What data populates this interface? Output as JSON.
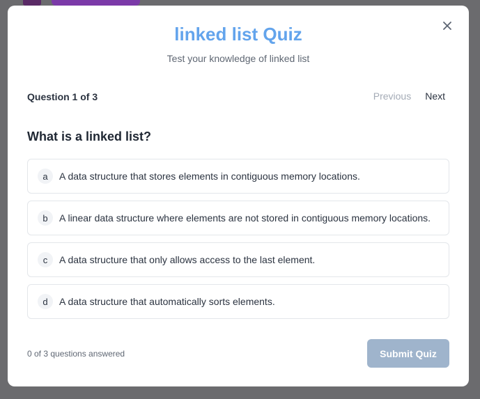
{
  "modal": {
    "title": "linked list Quiz",
    "subtitle": "Test your knowledge of linked list",
    "close_icon": "close-icon"
  },
  "quiz": {
    "progress_label": "Question 1 of 3",
    "previous_label": "Previous",
    "next_label": "Next",
    "question": "What is a linked list?",
    "options": [
      {
        "letter": "a",
        "text": "A data structure that stores elements in contiguous memory locations."
      },
      {
        "letter": "b",
        "text": "A linear data structure where elements are not stored in contiguous memory locations."
      },
      {
        "letter": "c",
        "text": "A data structure that only allows access to the last element."
      },
      {
        "letter": "d",
        "text": "A data structure that automatically sorts elements."
      }
    ]
  },
  "footer": {
    "answered_status": "0 of 3 questions answered",
    "submit_label": "Submit Quiz"
  },
  "colors": {
    "title": "#63a4ec",
    "submit_disabled": "#9fb4cc",
    "backdrop": "#6b6b6e"
  }
}
